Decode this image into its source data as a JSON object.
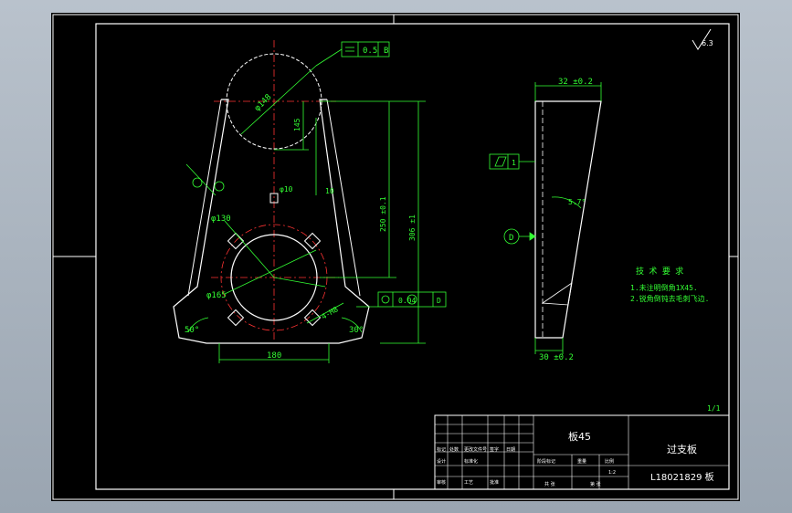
{
  "drawing": {
    "title_block": {
      "material": "板45",
      "part_name": "过支板",
      "drawing_no": "L18021829 板",
      "corner_note": "1/1",
      "scale": "1:2",
      "cells": [
        "标记",
        "处数",
        "更改文件号",
        "签字",
        "日期",
        "设计",
        "标准化",
        "阶段标记",
        "重量",
        "比例",
        "审核",
        "工艺",
        "批准",
        "共 张",
        "第 张"
      ]
    },
    "roughness_symbol": "6.3",
    "tech_requirements": {
      "title": "技 术 要 求",
      "items": [
        "1.未注明倒角1X45.",
        "2.锐角倒钝去毛刺飞边."
      ]
    },
    "front_view": {
      "dim_circle_top": "φ148",
      "dim_hole_small": "φ10",
      "dim_bore": "φ130",
      "dim_bolt_circle": "φ165",
      "dim_bottom_width": "180",
      "dim_angle_left": "50°",
      "dim_angle_right": "30°",
      "dim_145": "145",
      "dim_250": "250 ±0.1",
      "dim_306": "306 ±1",
      "dim_thread": "4-M8",
      "dim_10": "10",
      "dim_16": "16",
      "flatness_value": "0.5",
      "position_value": "0.04"
    },
    "side_view": {
      "dim_top": "32 ±0.2",
      "dim_bottom": "30 ±0.2",
      "dim_angle": "5.7°",
      "datum": "D"
    }
  },
  "colors": {
    "background": "#000000",
    "outline": "#ffffff",
    "dimension": "#33ff33",
    "center_line": "#ff3333",
    "frame_bg": "#a9b3bd"
  }
}
